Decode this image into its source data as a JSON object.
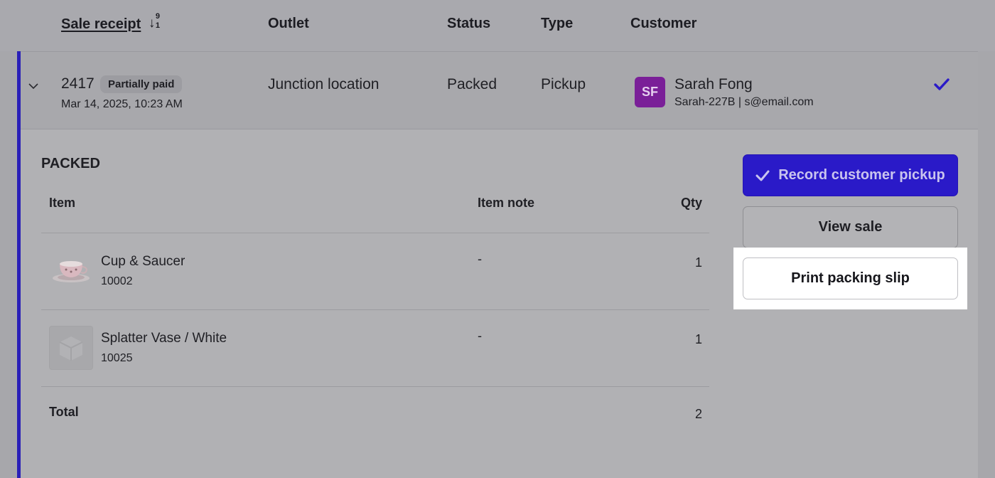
{
  "header": {
    "sale_receipt": "Sale receipt",
    "sort_arrow": "↓",
    "sort_top": "9",
    "sort_bottom": "1",
    "outlet": "Outlet",
    "status": "Status",
    "type": "Type",
    "customer": "Customer"
  },
  "sale": {
    "receipt_number": "2417",
    "payment_badge": "Partially paid",
    "date": "Mar 14, 2025, 10:23 AM",
    "outlet": "Junction location",
    "status": "Packed",
    "type": "Pickup",
    "customer": {
      "initials": "SF",
      "name": "Sarah Fong",
      "subtitle": "Sarah-227B | s@email.com",
      "avatar_color": "#7a1f98"
    }
  },
  "packed": {
    "section_title": "PACKED",
    "columns": {
      "item": "Item",
      "note": "Item note",
      "qty": "Qty"
    },
    "items": [
      {
        "name": "Cup & Saucer",
        "sku": "10002",
        "note": "-",
        "qty": "1",
        "thumb": "cup-saucer-photo"
      },
      {
        "name": "Splatter Vase / White",
        "sku": "10025",
        "note": "-",
        "qty": "1",
        "thumb": "box-placeholder-icon"
      }
    ],
    "total_label": "Total",
    "total_qty": "2"
  },
  "actions": {
    "record_pickup": "Record customer pickup",
    "view_sale": "View sale",
    "print_slip": "Print packing slip"
  },
  "colors": {
    "accent": "#2a20b8",
    "primary_button": "#2a1ac8",
    "overlay": "#a7a7ab"
  }
}
